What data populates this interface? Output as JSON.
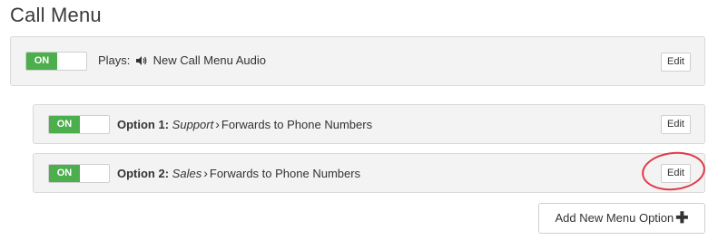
{
  "page": {
    "title": "Call Menu"
  },
  "main_menu": {
    "toggle": "ON",
    "plays_label": "Plays:",
    "audio_name": "New Call Menu Audio",
    "edit_label": "Edit"
  },
  "options": [
    {
      "toggle": "ON",
      "label": "Option 1:",
      "name": "Support",
      "action": "Forwards to Phone Numbers",
      "edit_label": "Edit"
    },
    {
      "toggle": "ON",
      "label": "Option 2:",
      "name": "Sales",
      "action": "Forwards to Phone Numbers",
      "edit_label": "Edit"
    }
  ],
  "add_option": {
    "label": "Add New Menu Option"
  },
  "colors": {
    "toggle_on": "#4cae4c",
    "annotation_circle": "#e03a4a"
  }
}
